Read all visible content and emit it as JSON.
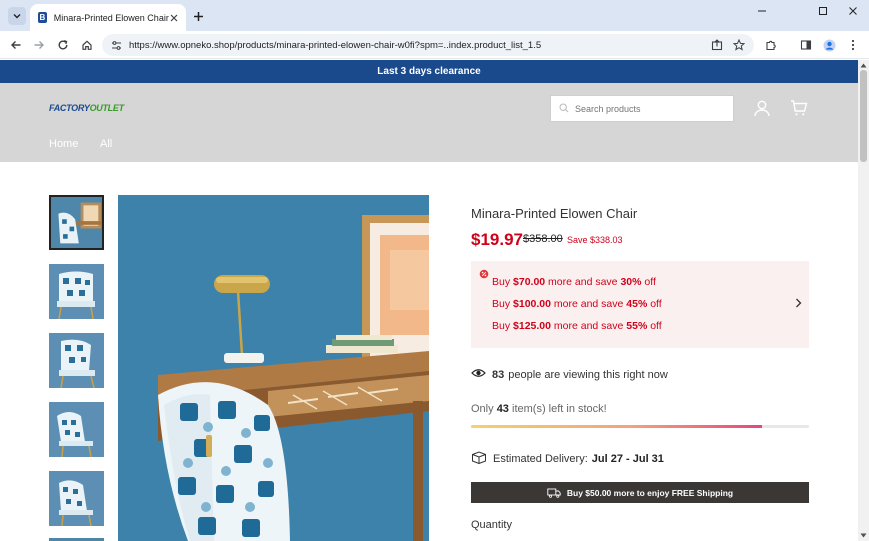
{
  "browser": {
    "tab_title": "Minara-Printed Elowen Chair",
    "favicon_letter": "B",
    "url": "https://www.opneko.shop/products/minara-printed-elowen-chair-w0fi?spm=..index.product_list_1.5"
  },
  "site": {
    "announcement": "Last 3 days clearance",
    "logo_main": "FACTORY",
    "logo_accent": "OUTLET",
    "search_placeholder": "Search products",
    "nav": [
      "Home",
      "All"
    ]
  },
  "product": {
    "title": "Minara-Printed Elowen Chair",
    "price": "$19.97",
    "compare_price": "$358.00",
    "save": "Save $338.03",
    "promos": [
      {
        "pre": "Buy ",
        "amount": "$70.00",
        "mid": " more and save ",
        "pct": "30%",
        "post": " off"
      },
      {
        "pre": "Buy ",
        "amount": "$100.00",
        "mid": " more and save ",
        "pct": "45%",
        "post": " off"
      },
      {
        "pre": "Buy ",
        "amount": "$125.00",
        "mid": " more and save ",
        "pct": "55%",
        "post": " off"
      }
    ],
    "viewing_count": "83",
    "viewing_text": "people are viewing this right now",
    "stock_prefix": "Only ",
    "stock_count": "43",
    "stock_suffix": " item(s) left in stock!",
    "stock_bar_fraction": 0.86,
    "delivery_label": "Estimated Delivery:",
    "delivery_dates": "Jul 27 - Jul 31",
    "shipping_text": "Buy $50.00 more to enjoy FREE Shipping",
    "quantity_label": "Quantity"
  },
  "colors": {
    "announcement_bg": "#1b4a8c",
    "price_red": "#d0021b",
    "shipping_bar_bg": "#3b3735"
  }
}
